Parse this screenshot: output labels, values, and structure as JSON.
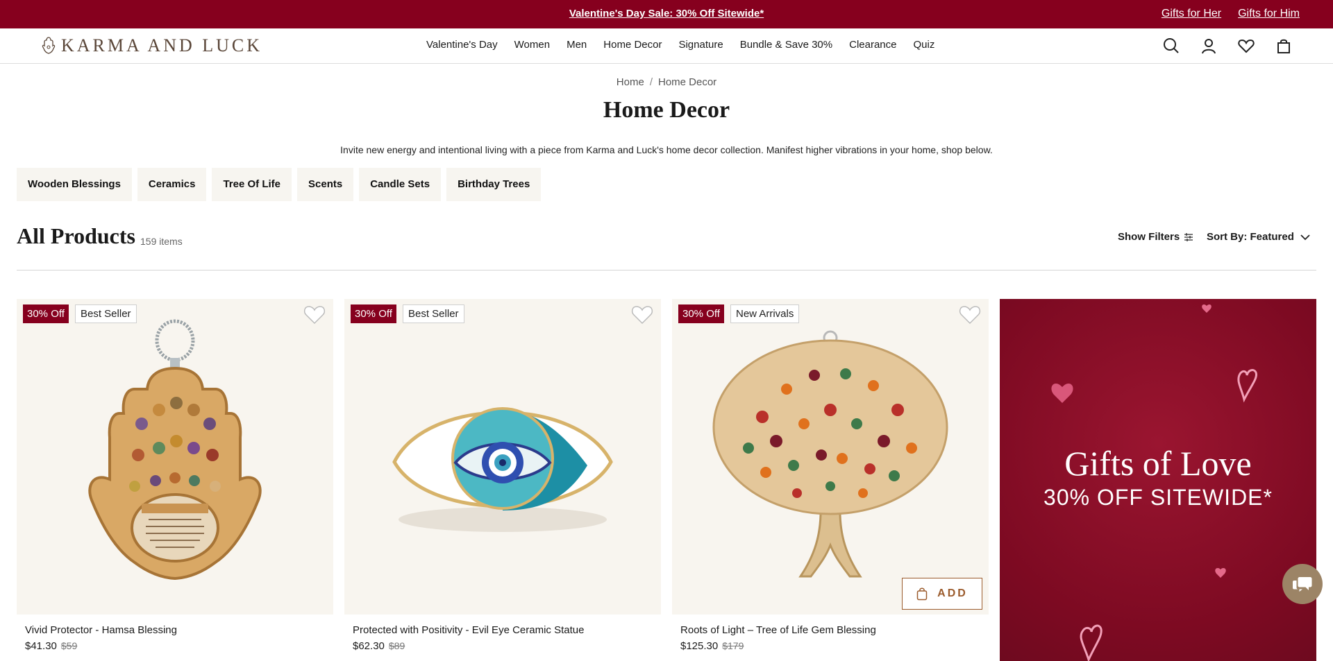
{
  "promo_bar": {
    "headline": "Valentine's Day Sale: 30% Off Sitewide*",
    "links": [
      "Gifts for Her",
      "Gifts for Him"
    ],
    "bg_color": "#86001e"
  },
  "header": {
    "logo_text": "KARMA AND LUCK",
    "nav": [
      "Valentine's Day",
      "Women",
      "Men",
      "Home Decor",
      "Signature",
      "Bundle & Save 30%",
      "Clearance",
      "Quiz"
    ],
    "icons": [
      "search-icon",
      "account-icon",
      "wishlist-heart-icon",
      "cart-bag-icon"
    ]
  },
  "breadcrumb": {
    "home": "Home",
    "separator": "/",
    "current": "Home Decor"
  },
  "page": {
    "title": "Home Decor",
    "description": "Invite new energy and intentional living with a piece from Karma and Luck's home decor collection. Manifest higher vibrations in your home, shop below."
  },
  "categories": [
    "Wooden Blessings",
    "Ceramics",
    "Tree Of Life",
    "Scents",
    "Candle Sets",
    "Birthday Trees"
  ],
  "products_header": {
    "title": "All Products",
    "count": "159 items",
    "filters_label": "Show Filters",
    "sort_label": "Sort By: Featured"
  },
  "products": [
    {
      "name": "Vivid Protector - Hamsa Blessing",
      "price": "$41.30",
      "old_price": "$59",
      "discount_badge": "30% Off",
      "tag": "Best Seller"
    },
    {
      "name": "Protected with Positivity - Evil Eye Ceramic Statue",
      "price": "$62.30",
      "old_price": "$89",
      "discount_badge": "30% Off",
      "tag": "Best Seller"
    },
    {
      "name": "Roots of Light – Tree of Life Gem Blessing",
      "price": "$125.30",
      "old_price": "$179",
      "discount_badge": "30% Off",
      "tag": "New Arrivals",
      "add_label": "ADD"
    }
  ],
  "promo_tile": {
    "title": "Gifts of Love",
    "subtitle": "30% OFF SITEWIDE*"
  },
  "colors": {
    "brand": "#86001e",
    "accent_brown": "#9b5b2c",
    "card_bg": "#f8f5ef"
  }
}
